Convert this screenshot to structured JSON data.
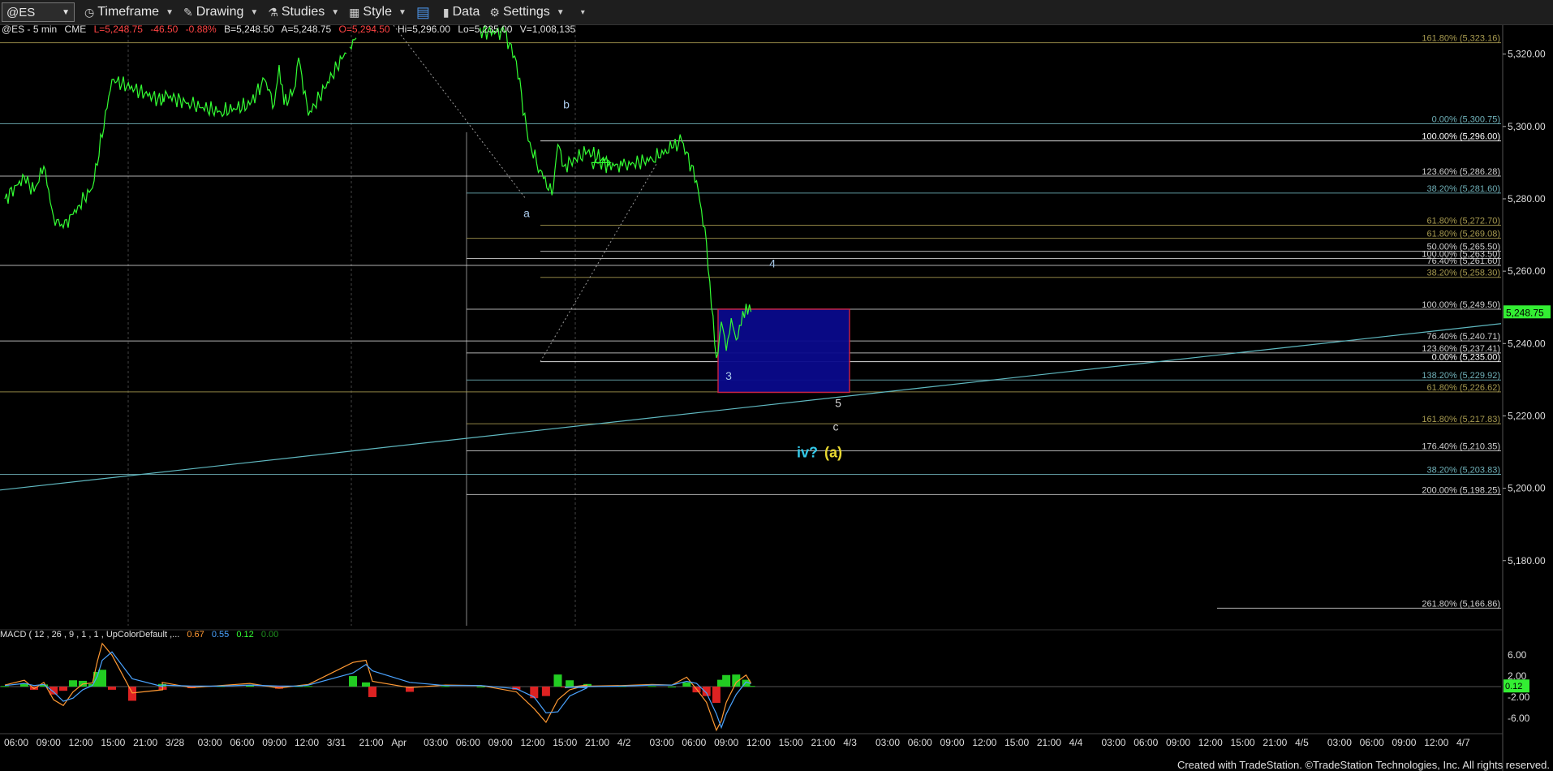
{
  "toolbar": {
    "symbol": "@ES",
    "timeframe": "Timeframe",
    "drawing": "Drawing",
    "studies": "Studies",
    "style": "Style",
    "data": "Data",
    "settings": "Settings"
  },
  "info": {
    "symbol": "@ES - 5 min",
    "exchange": "CME",
    "last": "L=5,248.75",
    "change": "-46.50",
    "pct": "-0.88%",
    "bid": "B=5,248.50",
    "ask": "A=5,248.75",
    "open": "O=5,294.50",
    "high": "Hi=5,296.00",
    "low": "Lo=5,235.00",
    "volume": "V=1,008,135"
  },
  "macd_header": {
    "label": "MACD ( 12 , 26 , 9 , 1 , 1 , UpColorDefault ,...",
    "v1": "0.67",
    "v2": "0.55",
    "v3": "0.12",
    "v4": "0.00",
    "current": "0.12",
    "colors": {
      "v1": "#ff9933",
      "v2": "#4aa3ff",
      "v3": "#33ff33",
      "v4": "#1f8f1f"
    }
  },
  "fib_levels": [
    {
      "label": "161.80% (5,323.16)",
      "price": 5323.16,
      "color": "#a89b50"
    },
    {
      "label": "0.00% (5,300.75)",
      "price": 5300.75,
      "color": "#6fb0b8"
    },
    {
      "label": "100.00% (5,296.00)",
      "price": 5296.0,
      "color": "#ffffff"
    },
    {
      "label": "123.60% (5,286.28)",
      "price": 5286.28,
      "color": "#d0d0d0"
    },
    {
      "label": "38.20% (5,281.60)",
      "price": 5281.6,
      "color": "#6fb0b8"
    },
    {
      "label": "61.80% (5,272.70)",
      "price": 5272.7,
      "color": "#a89b50"
    },
    {
      "label": "61.80% (5,269.08)",
      "price": 5269.08,
      "color": "#a89b50"
    },
    {
      "label": "50.00% (5,265.50)",
      "price": 5265.5,
      "color": "#d0d0d0"
    },
    {
      "label": "100.00% (5,263.50)",
      "price": 5263.5,
      "color": "#d0d0d0"
    },
    {
      "label": "76.40% (5,261.60)",
      "price": 5261.6,
      "color": "#d0d0d0"
    },
    {
      "label": "38.20% (5,258.30)",
      "price": 5258.3,
      "color": "#a89b50"
    },
    {
      "label": "100.00% (5,249.50)",
      "price": 5249.5,
      "color": "#d0d0d0"
    },
    {
      "label": "76.40% (5,240.71)",
      "price": 5240.71,
      "color": "#d0d0d0"
    },
    {
      "label": "123.60% (5,237.41)",
      "price": 5237.41,
      "color": "#d0d0d0"
    },
    {
      "label": "0.00% (5,235.00)",
      "price": 5235.0,
      "color": "#ffffff"
    },
    {
      "label": "138.20% (5,229.92)",
      "price": 5229.92,
      "color": "#6fb0b8"
    },
    {
      "label": "61.80% (5,226.62)",
      "price": 5226.62,
      "color": "#a89b50"
    },
    {
      "label": "161.80% (5,217.83)",
      "price": 5217.83,
      "color": "#a89b50"
    },
    {
      "label": "176.40% (5,210.35)",
      "price": 5210.35,
      "color": "#d0d0d0"
    },
    {
      "label": "38.20% (5,203.83)",
      "price": 5203.83,
      "color": "#6fb0b8"
    },
    {
      "label": "200.00% (5,198.25)",
      "price": 5198.25,
      "color": "#d0d0d0"
    },
    {
      "label": "261.80% (5,166.86)",
      "price": 5166.86,
      "color": "#d0d0d0"
    }
  ],
  "wave_labels": [
    {
      "text": "a",
      "time": "4/1 12:15",
      "price": 5275,
      "color": "#a8c8e8"
    },
    {
      "text": "b",
      "time": "4/1 15:00",
      "price": 5305,
      "color": "#a8c8e8"
    },
    {
      "text": "3",
      "time": "4/2 09:45",
      "price": 5230,
      "color": "#a8c8e8"
    },
    {
      "text": "4",
      "time": "4/2 12:30",
      "price": 5261,
      "color": "#a8c8e8"
    },
    {
      "text": "5",
      "time": "4/2 18:00",
      "price": 5222.5,
      "color": "#d0d0d0"
    },
    {
      "text": "c",
      "time": "4/2 18:00",
      "price": 5216,
      "color": "#d0d0d0"
    },
    {
      "text": "iv?",
      "time": "4/2 17:30",
      "price": 5208.5,
      "color": "#33c8e8"
    },
    {
      "text": "(a)",
      "time": "4/2 18:00",
      "price": 5208.5,
      "color": "#e8d830"
    }
  ],
  "footer": "Created with TradeStation. ©TradeStation Technologies, Inc. All rights reserved.",
  "chart_data": {
    "type": "line",
    "title": "@ES - 5 min",
    "y_range": [
      5162,
      5328
    ],
    "y_ticks": [
      "5,320.00",
      "5,300.00",
      "5,280.00",
      "5,260.00",
      "5,240.00",
      "5,220.00",
      "5,200.00",
      "5,180.00"
    ],
    "y_tick_values": [
      5320,
      5300,
      5280,
      5260,
      5240,
      5220,
      5200,
      5180
    ],
    "last_price": "5,248.75",
    "last_price_value": 5248.75,
    "x_labels": [
      "06:00",
      "09:00",
      "12:00",
      "15:00",
      "21:00",
      "3/28",
      "03:00",
      "06:00",
      "09:00",
      "12:00",
      "3/31",
      "21:00",
      "Apr",
      "03:00",
      "06:00",
      "09:00",
      "12:00",
      "15:00",
      "21:00",
      "4/2",
      "03:00",
      "06:00",
      "09:00",
      "12:00",
      "15:00",
      "21:00",
      "4/3",
      "03:00",
      "06:00",
      "09:00",
      "12:00",
      "15:00",
      "21:00",
      "4/4",
      "03:00",
      "06:00",
      "09:00",
      "12:00",
      "15:00",
      "21:00",
      "4/5",
      "03:00",
      "06:00",
      "09:00",
      "12:00",
      "4/7"
    ],
    "series": [
      {
        "color": "#33ff33",
        "x": [
          "3/27 06:00",
          "3/27 08:00",
          "3/27 09:00",
          "3/27 10:00",
          "3/27 11:00",
          "3/27 12:00",
          "3/27 13:30",
          "3/27 15:00",
          "3/27 17:00",
          "3/27 21:00",
          "3/28 00:00",
          "3/28 03:00",
          "3/28 06:00",
          "3/28 09:00",
          "3/28 10:30",
          "3/28 11:30",
          "3/28 12:00",
          "3/28 12:30",
          "3/28 13:30",
          "3/28 14:00",
          "3/28 15:00",
          "3/31 18:00",
          "3/31 20:00",
          "4/1 08:00",
          "4/1 09:00",
          "4/1 10:00",
          "4/1 11:00",
          "4/1 12:00",
          "4/1 12:30",
          "4/1 13:00",
          "4/1 14:00",
          "4/1 15:00",
          "4/1 17:00",
          "4/1 21:00",
          "4/2 00:00",
          "4/2 03:00",
          "4/2 05:00",
          "4/2 06:00",
          "4/2 07:30",
          "4/2 08:30",
          "4/2 09:00",
          "4/2 09:30",
          "4/2 10:00",
          "4/2 10:30",
          "4/2 11:00",
          "4/2 11:30",
          "4/2 12:00",
          "4/2 12:30",
          "4/2 13:00"
        ],
        "y": [
          5280,
          5286,
          5282,
          5289,
          5275,
          5272,
          5278,
          5283,
          5313,
          5307,
          5309,
          5306,
          5304,
          5306,
          5313,
          5306,
          5317,
          5306,
          5310,
          5319,
          5303,
          5324,
          5328,
          5326,
          5318,
          5296,
          5288,
          5281,
          5295,
          5289,
          5291,
          5293,
          5290,
          5290,
          5289,
          5291,
          5294,
          5296,
          5285,
          5268,
          5250,
          5236,
          5246,
          5238,
          5247,
          5241,
          5245,
          5251,
          5248.75
        ]
      }
    ],
    "trendline": {
      "x": [
        "3/27 06:00",
        "4/7 06:00"
      ],
      "y": [
        5199.5,
        5245.5
      ],
      "color": "#5fb8c0"
    },
    "target_box": {
      "x": [
        "4/2 09:00",
        "4/2 18:00"
      ],
      "y": [
        5249.5,
        5226.5
      ],
      "fill": "#0a0a8c",
      "border": "#cc2244"
    },
    "macd": {
      "y_ticks": [
        "6.00",
        "2.00",
        "-2.00",
        "-6.00"
      ],
      "y_tick_values": [
        6,
        2,
        -2,
        -6
      ],
      "y_range": [
        -8.5,
        8.5
      ],
      "x": [
        "3/27 06:00",
        "3/27 08:00",
        "3/27 09:00",
        "3/27 10:00",
        "3/27 11:00",
        "3/27 12:00",
        "3/27 13:00",
        "3/27 14:00",
        "3/27 15:00",
        "3/27 15:30",
        "3/27 16:00",
        "3/27 17:00",
        "3/27 18:00",
        "3/27 21:00",
        "3/28 00:00",
        "3/28 03:00",
        "3/28 06:00",
        "3/28 09:00",
        "3/28 12:00",
        "3/28 14:00",
        "3/28 15:00",
        "3/31 18:00",
        "3/31 20:00",
        "3/31 21:00",
        "4/1 00:00",
        "4/1 03:00",
        "4/1 06:00",
        "4/1 09:00",
        "4/1 10:30",
        "4/1 11:30",
        "4/1 12:30",
        "4/1 13:30",
        "4/1 15:00",
        "4/1 18:00",
        "4/1 21:00",
        "4/2 00:00",
        "4/2 03:00",
        "4/2 05:00",
        "4/2 06:30",
        "4/2 07:30",
        "4/2 08:30",
        "4/2 09:30",
        "4/2 10:00",
        "4/2 10:30",
        "4/2 11:30",
        "4/2 12:30",
        "4/2 13:00"
      ],
      "macd": [
        0.3,
        1.2,
        -0.4,
        0.8,
        -2.5,
        -3.6,
        -1.0,
        0.5,
        0.7,
        4.8,
        8.2,
        6.0,
        -1.2,
        -0.6,
        0.8,
        -0.2,
        0.2,
        0.6,
        -0.3,
        0.2,
        0.4,
        4.6,
        5.0,
        1.0,
        -0.2,
        0.3,
        0.2,
        -1.0,
        -4.2,
        -6.8,
        -2.5,
        -0.6,
        0.3,
        -0.2,
        0.1,
        0.2,
        0.4,
        0.3,
        1.8,
        -0.5,
        -3.0,
        -8.3,
        -6.5,
        -3.0,
        0.8,
        2.2,
        0.67
      ],
      "signal": [
        0.2,
        0.6,
        0.2,
        0.4,
        -1.0,
        -2.8,
        -2.2,
        -0.6,
        0.2,
        2.0,
        5.0,
        6.6,
        1.5,
        0.0,
        0.3,
        0.1,
        0.1,
        0.3,
        0.1,
        0.1,
        0.3,
        2.6,
        4.2,
        3.0,
        0.8,
        0.2,
        0.2,
        -0.4,
        -2.0,
        -5.0,
        -4.8,
        -1.8,
        -0.2,
        -0.1,
        0.0,
        0.1,
        0.3,
        0.3,
        1.0,
        0.6,
        -1.2,
        -5.2,
        -7.8,
        -5.2,
        -1.5,
        0.9,
        0.55
      ],
      "hist": [
        0.1,
        0.6,
        -0.6,
        0.4,
        -1.5,
        -0.8,
        1.2,
        1.1,
        0.5,
        2.8,
        3.2,
        -0.6,
        -2.7,
        -0.6,
        0.5,
        -0.3,
        0.1,
        0.3,
        -0.4,
        0.1,
        0.1,
        2.0,
        0.8,
        -2.0,
        -1.0,
        0.1,
        0.0,
        -0.6,
        -2.2,
        -1.8,
        2.3,
        1.2,
        0.5,
        -0.1,
        0.1,
        0.1,
        0.1,
        0.0,
        0.8,
        -1.1,
        -1.8,
        -3.1,
        1.3,
        2.2,
        2.3,
        1.3,
        0.12
      ]
    }
  }
}
